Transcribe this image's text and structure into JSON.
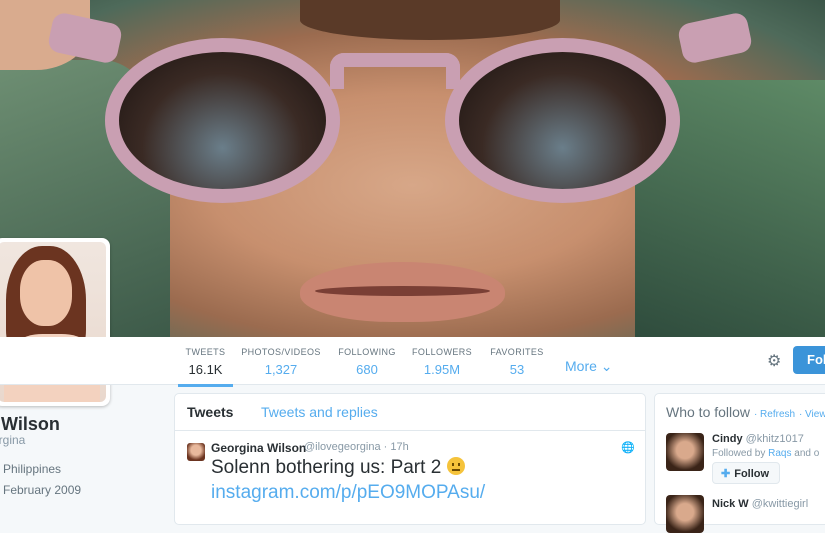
{
  "profile": {
    "name": "ina Wilson",
    "handle": "orgina",
    "location": "Philippines",
    "joined": "February 2009"
  },
  "stats": [
    {
      "label": "TWEETS",
      "value": "16.1K"
    },
    {
      "label": "PHOTOS/VIDEOS",
      "value": "1,327"
    },
    {
      "label": "FOLLOWING",
      "value": "680"
    },
    {
      "label": "FOLLOWERS",
      "value": "1.95M"
    },
    {
      "label": "FAVORITES",
      "value": "53"
    }
  ],
  "nav": {
    "more_label": "More",
    "follow_label": "Foll"
  },
  "timeline": {
    "tab_tweets": "Tweets",
    "tab_replies": "Tweets and replies",
    "tweet": {
      "name": "Georgina Wilson",
      "handle": "@ilovegeorgina · 17h",
      "text": "Solenn bothering us: Part 2",
      "link": "instagram.com/p/pEO9MOPAsu/"
    }
  },
  "who_to_follow": {
    "title": "Who to follow",
    "refresh": "· Refresh",
    "view_all": "· View",
    "users": [
      {
        "name": "Cindy",
        "handle": "@khitz1017",
        "followed_by_prefix": "Followed by",
        "followed_by_name": "Raqs",
        "followed_by_suffix": "and o",
        "follow_label": "Follow"
      },
      {
        "name": "Nick W",
        "handle": "@kwittiegirl"
      }
    ]
  },
  "colors": {
    "accent": "#55acee",
    "follow_button": "#3b94d9",
    "text": "#292f33",
    "muted": "#8899a6"
  }
}
